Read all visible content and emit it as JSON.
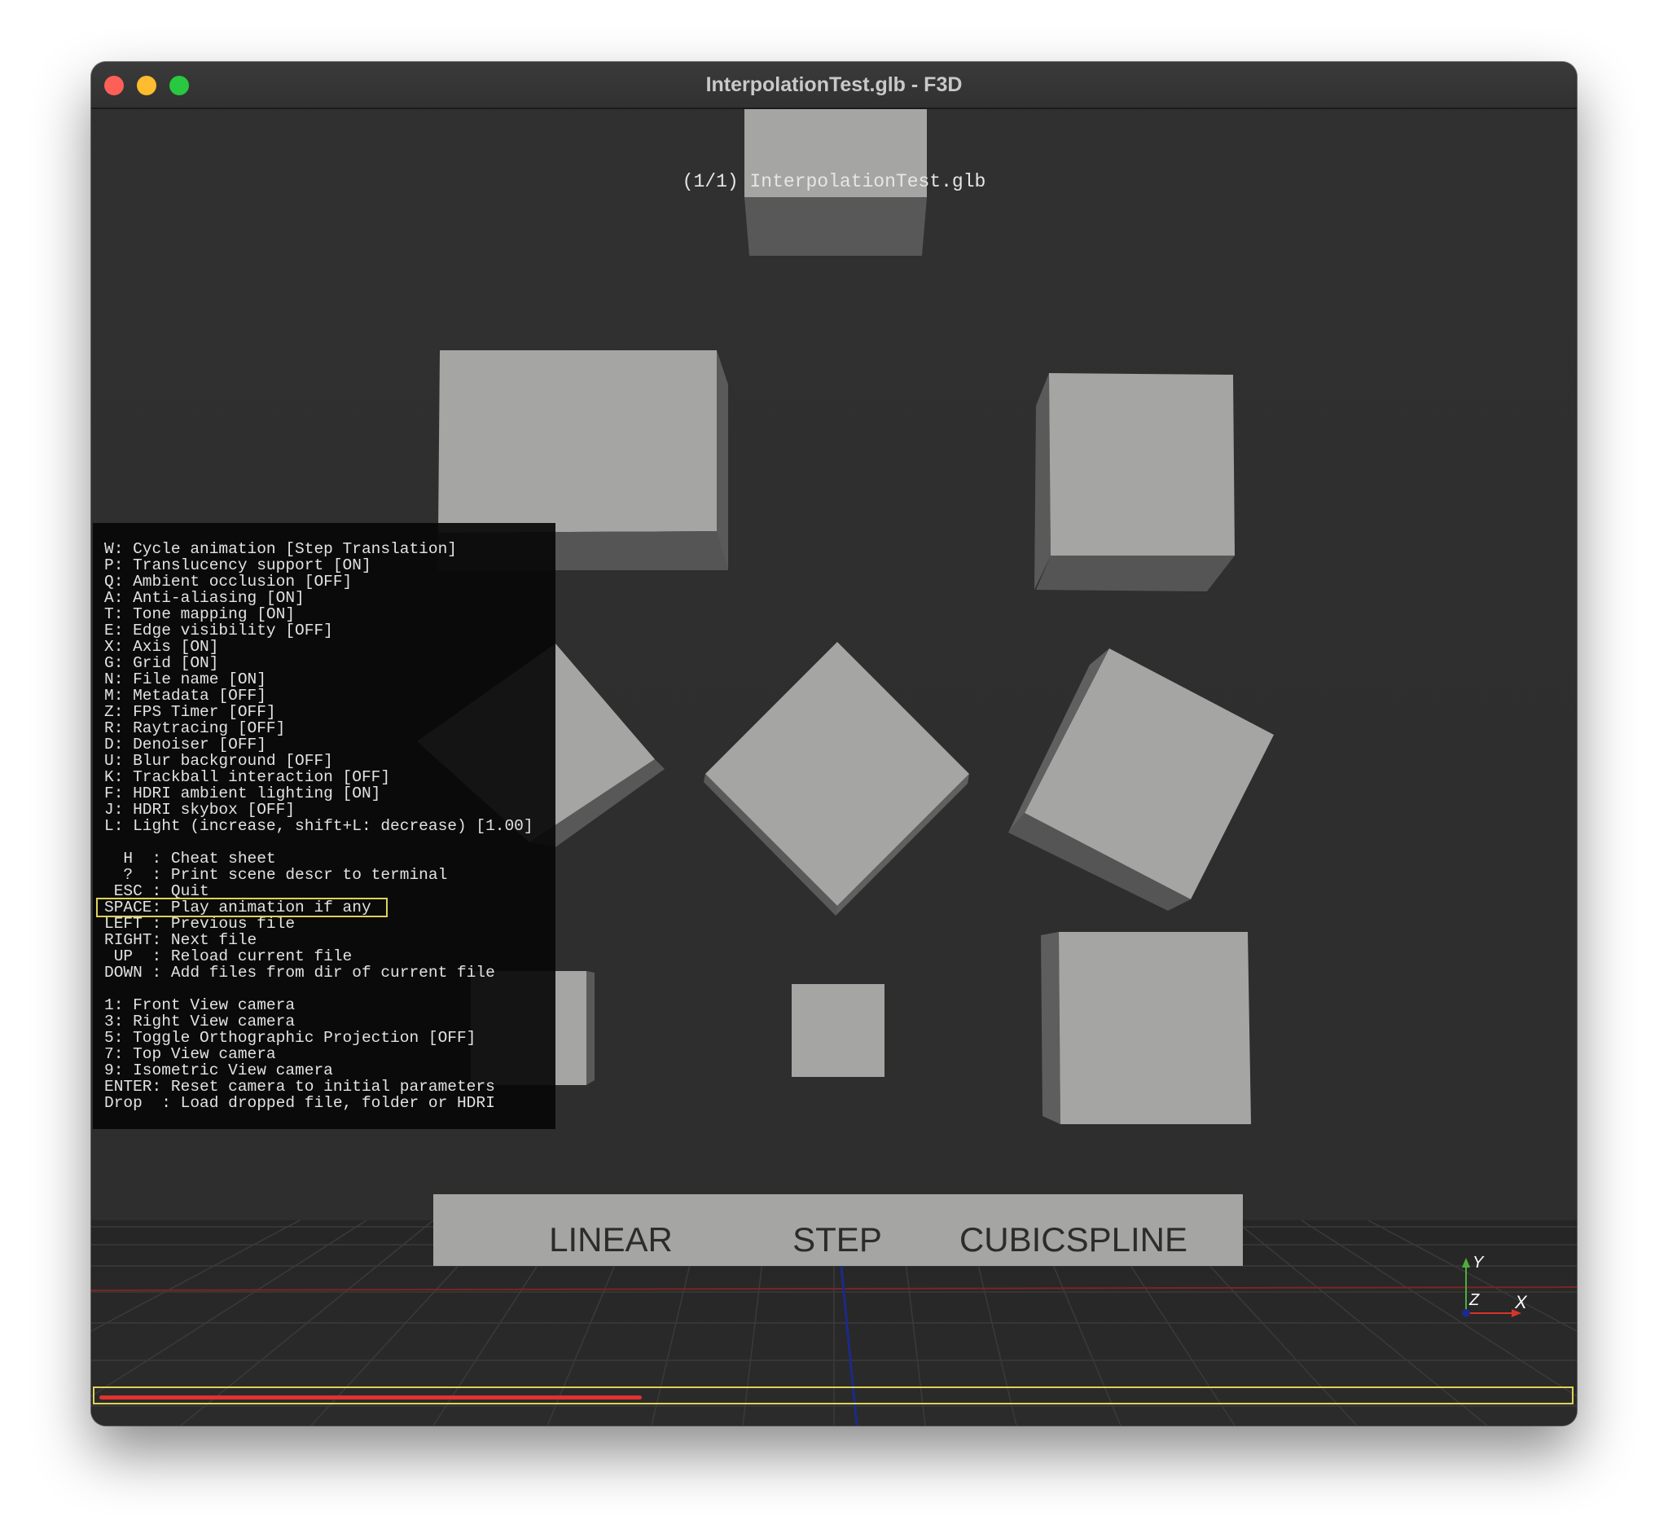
{
  "window": {
    "title": "InterpolationTest.glb - F3D"
  },
  "viewport": {
    "filename_overlay": "(1/1) InterpolationTest.glb",
    "labels_plane": {
      "items": [
        "LINEAR",
        "STEP",
        "CUBICSPLINE"
      ]
    },
    "axis_gizmo": {
      "y": "Y",
      "z": "Z",
      "x": "X"
    },
    "animation_progress": 0.37
  },
  "cheatsheet": {
    "lines": [
      "W: Cycle animation [Step Translation]",
      "P: Translucency support [ON]",
      "Q: Ambient occlusion [OFF]",
      "A: Anti-aliasing [ON]",
      "T: Tone mapping [ON]",
      "E: Edge visibility [OFF]",
      "X: Axis [ON]",
      "G: Grid [ON]",
      "N: File name [ON]",
      "M: Metadata [OFF]",
      "Z: FPS Timer [OFF]",
      "R: Raytracing [OFF]",
      "D: Denoiser [OFF]",
      "U: Blur background [OFF]",
      "K: Trackball interaction [OFF]",
      "F: HDRI ambient lighting [ON]",
      "J: HDRI skybox [OFF]",
      "L: Light (increase, shift+L: decrease) [1.00]",
      "",
      "  H  : Cheat sheet",
      "  ?  : Print scene descr to terminal",
      " ESC : Quit",
      "SPACE: Play animation if any",
      "LEFT : Previous file",
      "RIGHT: Next file",
      " UP  : Reload current file",
      "DOWN : Add files from dir of current file",
      "",
      "1: Front View camera",
      "3: Right View camera",
      "5: Toggle Orthographic Projection [OFF]",
      "7: Top View camera",
      "9: Isometric View camera",
      "ENTER: Reset camera to initial parameters",
      "Drop  : Load dropped file, folder or HDRI"
    ],
    "highlighted_index": 22
  },
  "colors": {
    "background": "#2f2f2f",
    "cube_front": "#a5a5a3",
    "cube_side": "#585858",
    "highlight": "#ded257",
    "progress": "#e0332f",
    "axis_x": "#d9332b",
    "axis_y": "#4fae3a",
    "axis_z": "#1c2a8a"
  }
}
